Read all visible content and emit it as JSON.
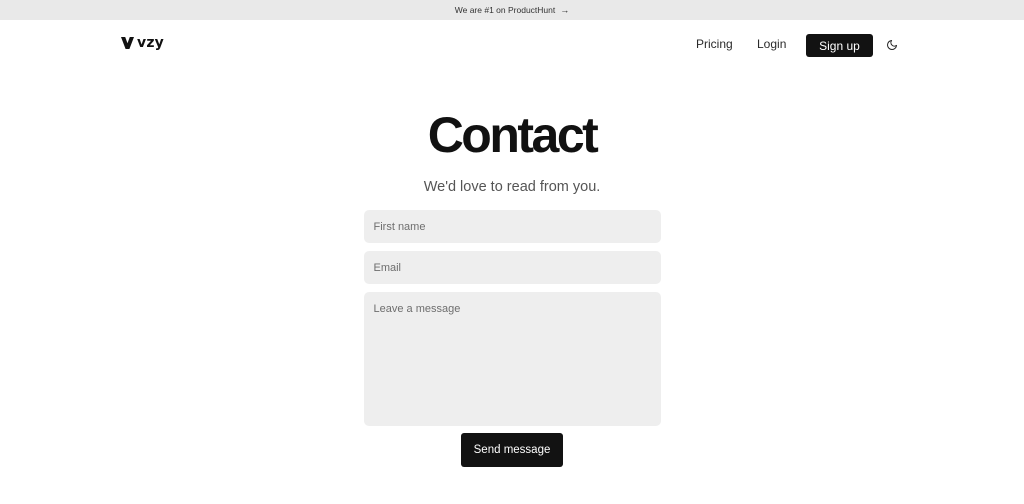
{
  "announcement": {
    "text": "We are #1 on ProductHunt",
    "icon": "arrow-right-icon",
    "arrow": "→"
  },
  "header": {
    "logo_text": "vzy",
    "logo_icon": "v-logo-icon",
    "nav": {
      "pricing": "Pricing",
      "login": "Login"
    },
    "signup_label": "Sign up",
    "theme_icon": "moon-icon"
  },
  "contact": {
    "title": "Contact",
    "subtitle": "We'd love to read from you.",
    "fields": {
      "first_name": {
        "placeholder": "First name",
        "value": ""
      },
      "email": {
        "placeholder": "Email",
        "value": ""
      },
      "message": {
        "placeholder": "Leave a message",
        "value": ""
      }
    },
    "submit_label": "Send message"
  },
  "colors": {
    "primary_button": "#121212",
    "field_background": "#eeeeee",
    "announcement_background": "#e9e9e9"
  }
}
